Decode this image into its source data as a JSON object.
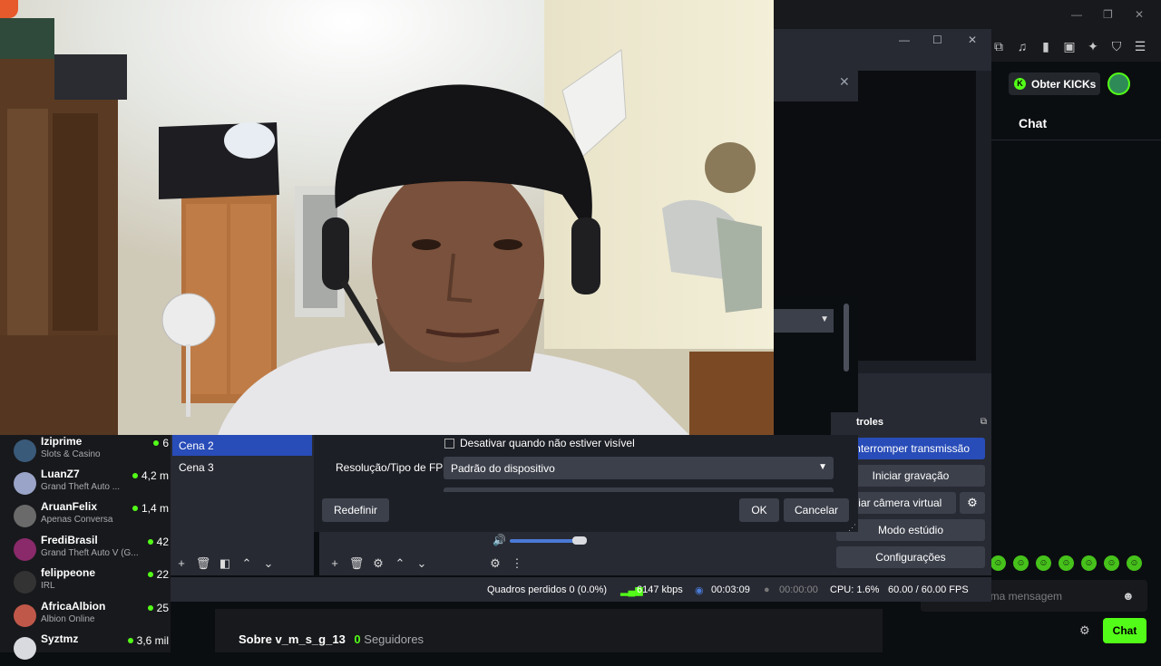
{
  "kick": {
    "obter_kicks": "Obter KICKs",
    "chat_title": "Chat",
    "chat_placeholder": "uma mensagem",
    "chat_button": "Chat",
    "about_title": "Sobre v_m_s_g_13",
    "followers_count": "0",
    "followers_label": "Seguidores",
    "accent_color": "#53fc18",
    "sidebar": [
      {
        "name": "Iziprime",
        "game": "Slots & Casino",
        "viewers": "6"
      },
      {
        "name": "LuanZ7",
        "game": "Grand Theft Auto ...",
        "viewers": "4,2 m"
      },
      {
        "name": "AruanFelix",
        "game": "Apenas Conversa",
        "viewers": "1,4 m"
      },
      {
        "name": "FrediBrasil",
        "game": "Grand Theft Auto V (G...",
        "viewers": "42"
      },
      {
        "name": "felippeone",
        "game": "IRL",
        "viewers": "22"
      },
      {
        "name": "AfricaAlbion",
        "game": "Albion Online",
        "viewers": "25"
      },
      {
        "name": "Syztmz",
        "game": "",
        "viewers": "3,6 mil"
      }
    ]
  },
  "obs": {
    "controls_title": "troles",
    "controls": {
      "stop_stream": "Interromper transmissão",
      "start_recording": "Iniciar gravação",
      "virtual_camera": "iciar câmera virtual",
      "studio_mode": "Modo estúdio",
      "settings": "Configurações"
    },
    "scenes": [
      "Cena 2",
      "Cena 3"
    ],
    "properties": {
      "deactivate_checkbox": "Desativar quando não estiver visível",
      "fps_label": "Resolução/Tipo de FPS",
      "fps_value": "Padrão do dispositivo",
      "reset": "Redefinir",
      "ok": "OK",
      "cancel": "Cancelar"
    },
    "status": {
      "dropped_frames": "Quadros perdidos 0 (0.0%)",
      "bitrate": "6147 kbps",
      "stream_time": "00:03:09",
      "record_time": "00:00:00",
      "cpu": "CPU: 1.6%",
      "fps": "60.00 / 60.00 FPS"
    },
    "volume_level": 0.85
  }
}
